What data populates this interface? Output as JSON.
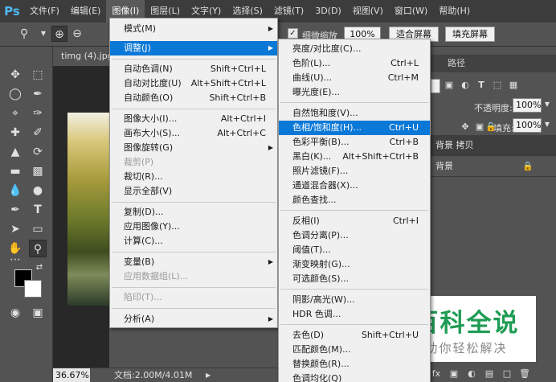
{
  "menubar": {
    "logo": "Ps",
    "items": [
      "文件(F)",
      "编辑(E)",
      "图像(I)",
      "图层(L)",
      "文字(Y)",
      "选择(S)",
      "滤镜(T)",
      "3D(D)",
      "视图(V)",
      "窗口(W)",
      "帮助(H)"
    ]
  },
  "options": {
    "resize_windows_label": "细微缩放",
    "zoom_value": "100%",
    "fit_screen_label": "适合屏幕",
    "fill_screen_label": "填充屏幕"
  },
  "document": {
    "tab_title": "timg (4).jpg",
    "zoom": "36.67%",
    "doc_info": "文档:2.00M/4.01M"
  },
  "panels": {
    "paths_tab": "路径",
    "opacity_label": "不透明度:",
    "opacity_value": "100%",
    "fill_label": "填充:",
    "fill_value": "100%",
    "layers": [
      "背景 拷贝",
      "背景"
    ]
  },
  "image_menu": {
    "items": [
      {
        "label": "模式(M)",
        "shortcut": "",
        "submenu": true,
        "disabled": false
      },
      {
        "label": "调整(J)",
        "shortcut": "",
        "submenu": true,
        "disabled": false,
        "highlighted": true
      },
      {
        "label": "自动色调(N)",
        "shortcut": "Shift+Ctrl+L",
        "disabled": false
      },
      {
        "label": "自动对比度(U)",
        "shortcut": "Alt+Shift+Ctrl+L",
        "disabled": false
      },
      {
        "label": "自动颜色(O)",
        "shortcut": "Shift+Ctrl+B",
        "disabled": false
      },
      {
        "label": "图像大小(I)...",
        "shortcut": "Alt+Ctrl+I",
        "disabled": false
      },
      {
        "label": "画布大小(S)...",
        "shortcut": "Alt+Ctrl+C",
        "disabled": false
      },
      {
        "label": "图像旋转(G)",
        "shortcut": "",
        "submenu": true,
        "disabled": false
      },
      {
        "label": "裁剪(P)",
        "shortcut": "",
        "disabled": true
      },
      {
        "label": "裁切(R)...",
        "shortcut": "",
        "disabled": false
      },
      {
        "label": "显示全部(V)",
        "shortcut": "",
        "disabled": false
      },
      {
        "label": "复制(D)...",
        "shortcut": "",
        "disabled": false
      },
      {
        "label": "应用图像(Y)...",
        "shortcut": "",
        "disabled": false
      },
      {
        "label": "计算(C)...",
        "shortcut": "",
        "disabled": false
      },
      {
        "label": "变量(B)",
        "shortcut": "",
        "submenu": true,
        "disabled": false
      },
      {
        "label": "应用数据组(L)...",
        "shortcut": "",
        "disabled": true
      },
      {
        "label": "陷印(T)...",
        "shortcut": "",
        "disabled": true
      },
      {
        "label": "分析(A)",
        "shortcut": "",
        "submenu": true,
        "disabled": false
      }
    ]
  },
  "adjust_menu": {
    "items": [
      {
        "label": "亮度/对比度(C)...",
        "shortcut": ""
      },
      {
        "label": "色阶(L)...",
        "shortcut": "Ctrl+L"
      },
      {
        "label": "曲线(U)...",
        "shortcut": "Ctrl+M"
      },
      {
        "label": "曝光度(E)...",
        "shortcut": ""
      },
      {
        "label": "自然饱和度(V)...",
        "shortcut": ""
      },
      {
        "label": "色相/饱和度(H)...",
        "shortcut": "Ctrl+U",
        "highlighted": true
      },
      {
        "label": "色彩平衡(B)...",
        "shortcut": "Ctrl+B"
      },
      {
        "label": "黑白(K)...",
        "shortcut": "Alt+Shift+Ctrl+B"
      },
      {
        "label": "照片滤镜(F)...",
        "shortcut": ""
      },
      {
        "label": "通道混合器(X)...",
        "shortcut": ""
      },
      {
        "label": "颜色查找...",
        "shortcut": ""
      },
      {
        "label": "反相(I)",
        "shortcut": "Ctrl+I"
      },
      {
        "label": "色调分离(P)...",
        "shortcut": ""
      },
      {
        "label": "阈值(T)...",
        "shortcut": ""
      },
      {
        "label": "渐变映射(G)...",
        "shortcut": ""
      },
      {
        "label": "可选颜色(S)...",
        "shortcut": ""
      },
      {
        "label": "阴影/高光(W)...",
        "shortcut": ""
      },
      {
        "label": "HDR 色调...",
        "shortcut": ""
      },
      {
        "label": "去色(D)",
        "shortcut": "Shift+Ctrl+U"
      },
      {
        "label": "匹配颜色(M)...",
        "shortcut": ""
      },
      {
        "label": "替换颜色(R)...",
        "shortcut": ""
      },
      {
        "label": "色调均化(Q)",
        "shortcut": ""
      }
    ]
  },
  "watermark": {
    "title": "百科全说",
    "subtitle": "助你轻松解决"
  }
}
